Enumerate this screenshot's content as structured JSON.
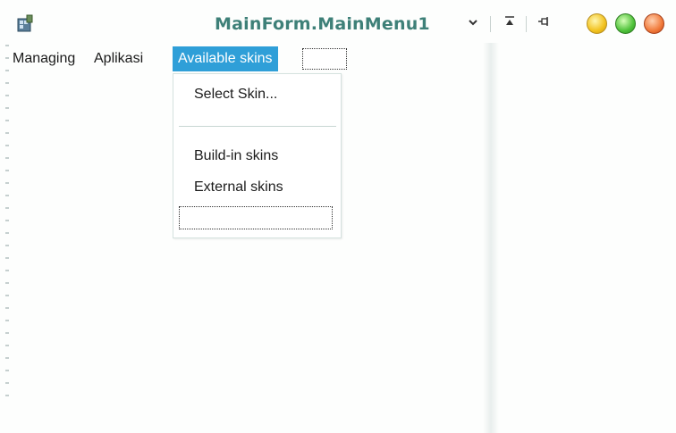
{
  "window": {
    "title": "MainForm.MainMenu1",
    "icon": "form-designer-icon",
    "controls": {
      "dropdown_icon": "chevron-down-icon",
      "pin_top_icon": "pin-to-top-icon",
      "pin_icon": "pushpin-icon",
      "dropdown_glyph": "⌄",
      "pin_top_glyph": "⊼",
      "pin_glyph": "⊣"
    },
    "orbs": [
      "yellow",
      "green",
      "red"
    ]
  },
  "menubar": {
    "items": [
      {
        "label": "Managing"
      },
      {
        "label": "Aplikasi"
      },
      {
        "label": "Available skins",
        "active": true
      }
    ],
    "accent_color": "#2f9fd8"
  },
  "dropdown": {
    "items": [
      {
        "label": "Select Skin..."
      },
      {
        "label": "Build-in skins"
      },
      {
        "label": "External skins"
      }
    ]
  }
}
